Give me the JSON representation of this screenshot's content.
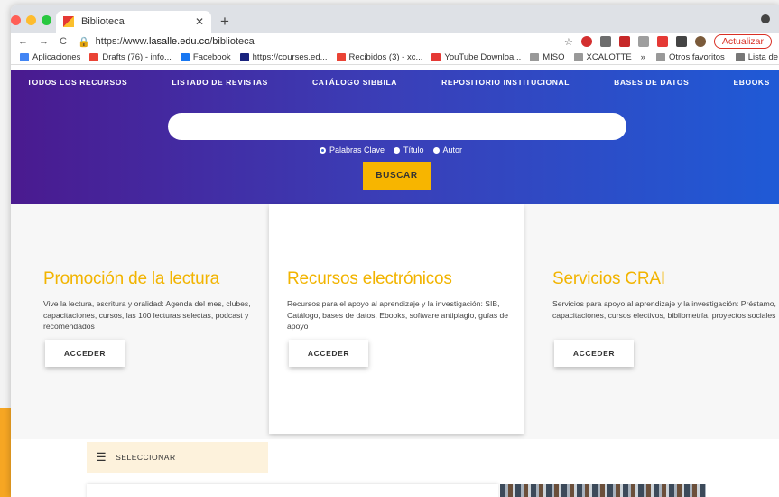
{
  "browser": {
    "tab_title": "Biblioteca",
    "url_prefix": "https://www.",
    "url_domain": "lasalle.edu.co",
    "url_path": "/biblioteca",
    "update_label": "Actualizar",
    "bookmarks": [
      "Aplicaciones",
      "Drafts (76) - info...",
      "Facebook",
      "https://courses.ed...",
      "Recibidos (3) - xc...",
      "YouTube Downloa...",
      "MISO",
      "XCALOTTE"
    ],
    "bookmarks_right": [
      "»",
      "Otros favoritos",
      "Lista de lectura"
    ]
  },
  "nav": [
    "TODOS LOS RECURSOS",
    "LISTADO DE REVISTAS",
    "CATÁLOGO SIBBILA",
    "REPOSITORIO INSTITUCIONAL",
    "BASES DE DATOS",
    "EBOOKS"
  ],
  "search": {
    "placeholder": "",
    "options": [
      "Palabras Clave",
      "Título",
      "Autor"
    ],
    "button": "BUSCAR"
  },
  "cards": [
    {
      "title": "Promoción de la lectura",
      "desc": "Vive la lectura, escritura y oralidad: Agenda del mes, clubes, capacitaciones, cursos, las 100 lecturas selectas, podcast y recomendados",
      "button": "ACCEDER"
    },
    {
      "title": "Recursos electrónicos",
      "desc": "Recursos para el apoyo al aprendizaje y la investigación: SIB, Catálogo, bases de datos, Ebooks, software antiplagio, guías de apoyo",
      "button": "ACCEDER"
    },
    {
      "title": "Servicios CRAI",
      "desc": "Servicios para apoyo al aprendizaje y la investigación: Préstamo, capacitaciones, cursos electivos, bibliometría, proyectos sociales",
      "button": "ACCEDER"
    }
  ],
  "select_label": "SELECCIONAR",
  "colors": {
    "accent": "#f2b400",
    "hero_start": "#4a1a8f",
    "hero_end": "#1f5ad6",
    "button": "#f7b500"
  }
}
